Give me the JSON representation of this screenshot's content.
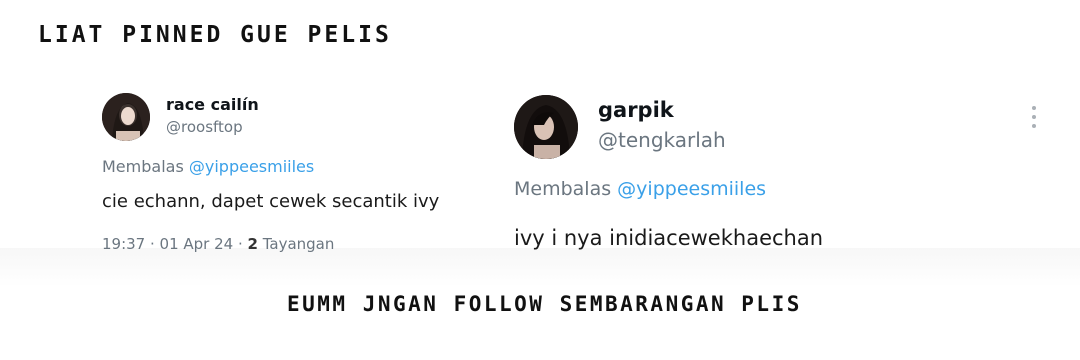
{
  "captions": {
    "top": "LiAT PiNNED GUE PELiS",
    "bottom": "EUMM JNGAN FOLLOW SEMBARANGAN PLiS"
  },
  "tweets": [
    {
      "display_name": "race cailín",
      "handle": "@roosftop",
      "reply_prefix": "Membalas",
      "reply_mention": "@yippeesmiiles",
      "text": "cie echann, dapet cewek secantik ivy",
      "time": "19:37 · 01 Apr 24 · ",
      "views_count": "2",
      "views_label": " Tayangan"
    },
    {
      "display_name": "garpik",
      "handle": "@tengkarlah",
      "reply_prefix": "Membalas",
      "reply_mention": "@yippeesmiiles",
      "text": "ivy i nya inidiacewekhaechan"
    }
  ],
  "colors": {
    "mention": "#3aa0e8",
    "muted": "#6b7680"
  },
  "icons": {
    "more": "more-vertical-icon"
  }
}
